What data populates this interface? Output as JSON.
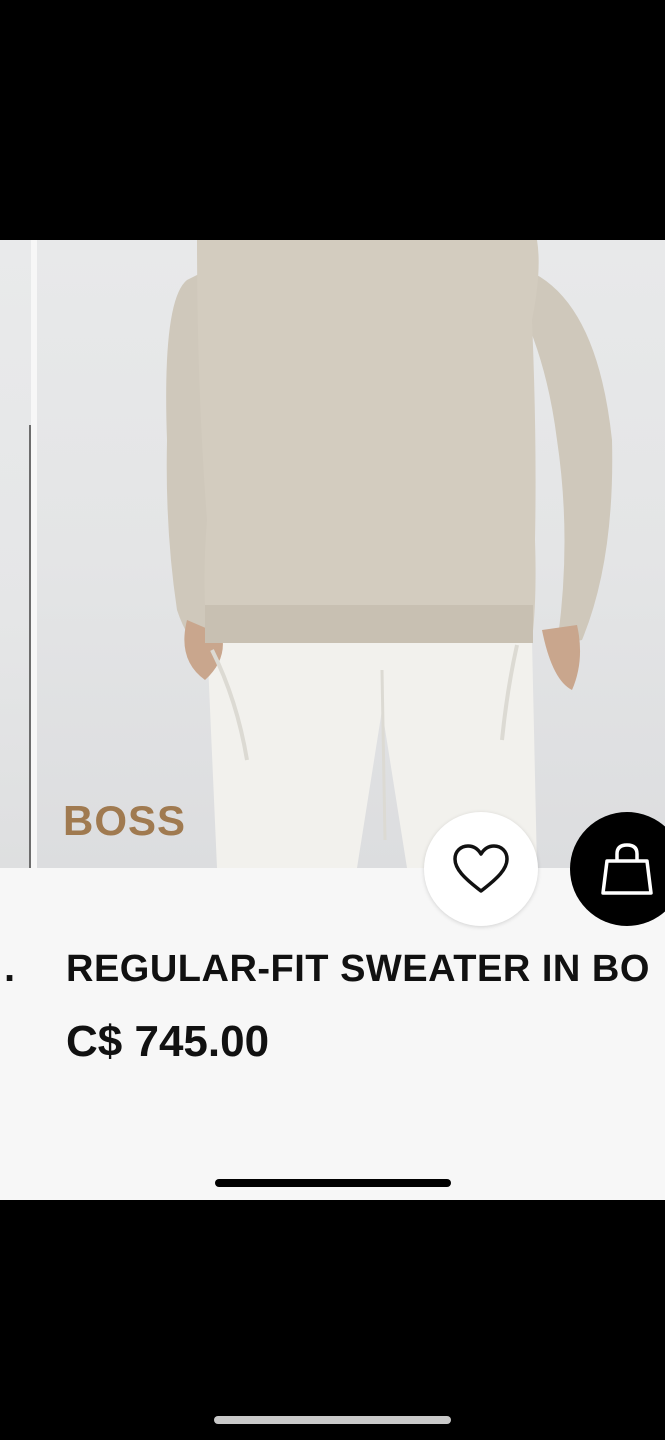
{
  "product": {
    "brand": "BOSS",
    "title": "REGULAR-FIT SWEATER IN BO",
    "price": "C$ 745.00"
  },
  "previous_card": {
    "title_fragment": "."
  },
  "actions": {
    "wishlist_icon": "heart-icon",
    "bag_icon": "shopping-bag-icon"
  },
  "colors": {
    "brand_gold": "#a07a50",
    "sweater": "#d3ccbf",
    "background": "#f7f7f7"
  }
}
